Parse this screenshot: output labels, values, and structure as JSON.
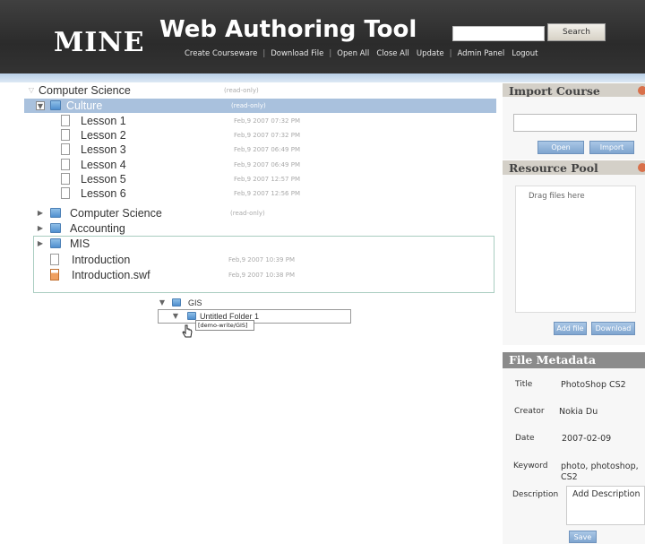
{
  "header": {
    "logo": "MINE",
    "title": "Web Authoring Tool",
    "search_label": "Search",
    "search_value": "",
    "nav": [
      "Create Courseware",
      "Download File",
      "Open All",
      "Close All",
      "Update",
      "Admin Panel",
      "Logout"
    ]
  },
  "tree": {
    "root": {
      "label": "Computer Science",
      "status": "(read-only)"
    },
    "culture": {
      "label": "Culture",
      "status": "(read-only)"
    },
    "lessons": [
      {
        "label": "Lesson 1",
        "ts": "Feb,9 2007 07:32 PM"
      },
      {
        "label": "Lesson 2",
        "ts": "Feb,9 2007 07:32 PM"
      },
      {
        "label": "Lesson 3",
        "ts": "Feb,9 2007 06:49 PM"
      },
      {
        "label": "Lesson 4",
        "ts": "Feb,9 2007 06:49 PM"
      },
      {
        "label": "Lesson 5",
        "ts": "Feb,9 2007 12:57 PM"
      },
      {
        "label": "Lesson 6",
        "ts": "Feb,9 2007 12:56 PM"
      }
    ],
    "cs_sub": {
      "label": "Computer Science",
      "status": "(read-only)"
    },
    "accounting": {
      "label": "Accounting"
    },
    "mis": {
      "label": "MIS"
    },
    "mis_files": [
      {
        "label": "Introduction",
        "ts": "Feb,9 2007 10:39 PM"
      },
      {
        "label": "Introduction.swf",
        "ts": "Feb,9 2007 10:38 PM"
      }
    ],
    "drag": {
      "gis_label": "GIS",
      "untitled_label": "Untitled Folder 1",
      "tooltip": "[demo-write/GIS]"
    }
  },
  "panels": {
    "import": {
      "title": "Import Course",
      "input_value": "",
      "open_label": "Open",
      "import_label": "Import"
    },
    "resource": {
      "title": "Resource Pool",
      "drop_text": "Drag files here",
      "add_label": "Add file",
      "download_label": "Download"
    },
    "metadata": {
      "title": "File Metadata",
      "fields": [
        {
          "key": "Title",
          "value": "PhotoShop CS2"
        },
        {
          "key": "Creator",
          "value": "Nokia Du"
        },
        {
          "key": "Date",
          "value": "2007-02-09"
        },
        {
          "key": "Keyword",
          "value": "photo, photoshop, CS2"
        }
      ],
      "description_key": "Description",
      "description_value": "Add Description",
      "save_label": "Save"
    }
  }
}
